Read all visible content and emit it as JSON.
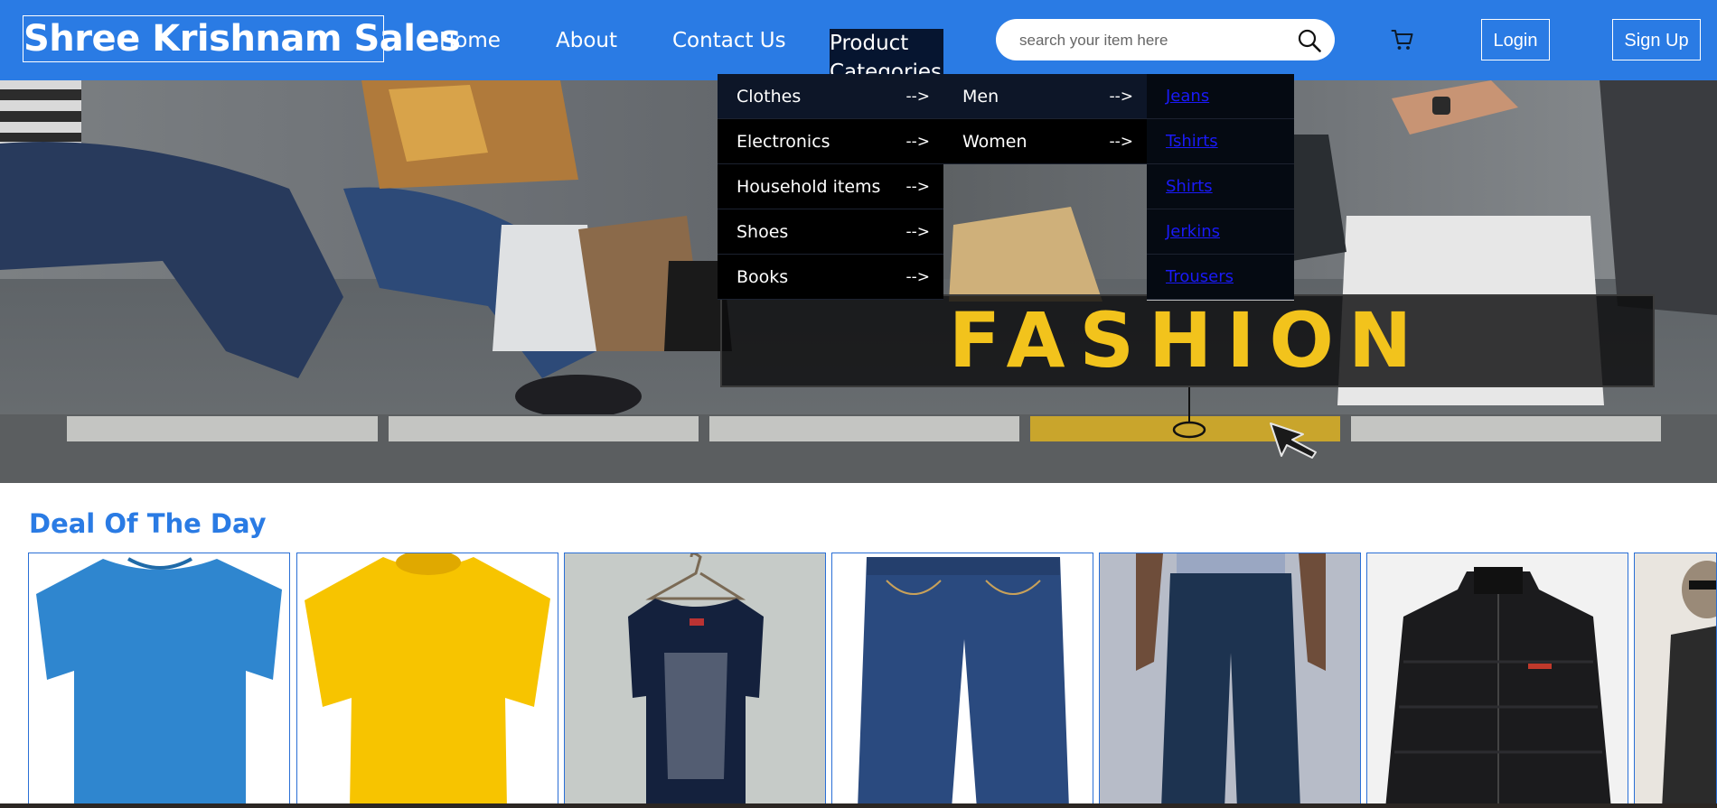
{
  "header": {
    "brand": "Shree Krishnam Sales",
    "nav": [
      "Home",
      "About",
      "Contact Us"
    ],
    "categories_label_line1": "Product",
    "categories_label_line2": "Categories",
    "search_placeholder": "search your item here",
    "search_icon": "search-icon",
    "cart_icon": "cart-icon",
    "login_label": "Login",
    "signup_label": "Sign Up",
    "accent_color": "#2a7be4"
  },
  "dropdown": {
    "level1": [
      {
        "label": "Clothes",
        "arrow": "-->"
      },
      {
        "label": "Electronics",
        "arrow": "-->"
      },
      {
        "label": "Household items",
        "arrow": "-->"
      },
      {
        "label": "Shoes",
        "arrow": "-->"
      },
      {
        "label": "Books",
        "arrow": "-->"
      }
    ],
    "level2": [
      {
        "label": "Men",
        "arrow": "-->"
      },
      {
        "label": "Women",
        "arrow": "-->"
      }
    ],
    "level3": [
      "Jeans",
      "Tshirts",
      "Shirts",
      "Jerkins",
      "Trousers"
    ],
    "link_color": "#1a1af7"
  },
  "hero": {
    "banner_text": "FASHION",
    "banner_text_color": "#f2c31c"
  },
  "deals": {
    "title": "Deal Of The Day",
    "items": [
      {
        "name": "blue-tshirt",
        "color": "#2f86cf"
      },
      {
        "name": "yellow-tshirt",
        "color": "#f7c400"
      },
      {
        "name": "navy-graphic-tshirt",
        "color": "#14213d"
      },
      {
        "name": "blue-jeans",
        "color": "#2a4a7f"
      },
      {
        "name": "model-jeans",
        "color": "#1d3350"
      },
      {
        "name": "black-jacket",
        "color": "#1b1b1d"
      },
      {
        "name": "partial-product",
        "color": "#9a8a78"
      }
    ]
  }
}
